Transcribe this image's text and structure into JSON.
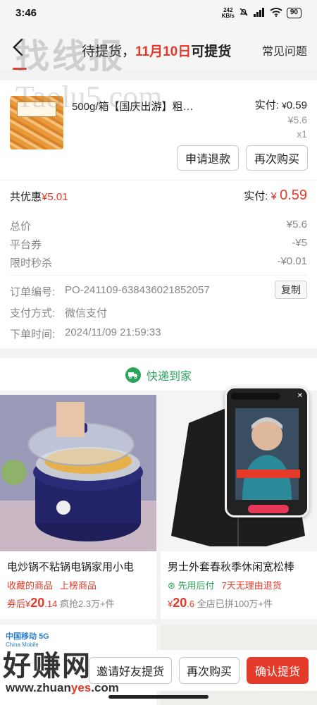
{
  "status_bar": {
    "time": "3:46",
    "speed": "242",
    "speed_unit": "KB/s",
    "battery": "90"
  },
  "header": {
    "title_prefix": "待提货，",
    "title_date": "11月10日",
    "title_suffix": "可提货",
    "faq": "常见问题"
  },
  "watermarks": {
    "top": "找线报",
    "mid": "Taolu5.com",
    "bottom": "好赚网",
    "bottom_url_a": "www.zhuan",
    "bottom_url_b": "yes",
    "bottom_url_c": ".com"
  },
  "product": {
    "name": "500g/箱【国庆出游】粗…",
    "paid_label": "实付:",
    "paid_currency": "¥",
    "paid_value": "0.59",
    "original_price": "¥5.6",
    "quantity": "x1",
    "refund_button": "申请退款",
    "rebuy_button": "再次购买"
  },
  "discount": {
    "label": "共优惠",
    "amount": "¥5.01",
    "paid_label": "实付:",
    "paid_currency": "¥",
    "paid_value": "0.59"
  },
  "breakdown": [
    {
      "label": "总价",
      "value": "¥5.6"
    },
    {
      "label": "平台券",
      "value": "-¥5"
    },
    {
      "label": "限时秒杀",
      "value": "-¥0.01"
    }
  ],
  "order_info": {
    "order_no_label": "订单编号:",
    "order_no": "PO-241109-638436021852057",
    "copy_button": "复制",
    "payment_label": "支付方式:",
    "payment": "微信支付",
    "time_label": "下单时间:",
    "time": "2024/11/09 21:59:33"
  },
  "express": {
    "label": "快递到家"
  },
  "recommendations": [
    {
      "title": "电炒锅不粘锅电锅家用小电",
      "tags": [
        "收藏的商品",
        "上榜商品"
      ],
      "price_prefix": "券后",
      "price_currency": "¥",
      "price_big": "20",
      "price_small": ".14",
      "sold": "疯抢2.3万+件"
    },
    {
      "title": "男士外套春秋季休闲宽松棒",
      "tags": [
        "先用后付",
        "7天无理由退货"
      ],
      "price_currency": "¥",
      "price_big": "20",
      "price_small": ".6",
      "sold": "全店已拼100万+件"
    }
  ],
  "ads": {
    "china_mobile": "中国移动",
    "china_mobile_en": "China Mobile",
    "fiveg": "5G"
  },
  "bottom_bar": {
    "friend_button": "邀请好友提货",
    "rebuy_button": "再次购买",
    "confirm_button": "确认提货"
  },
  "colors": {
    "accent": "#e43a2a",
    "green": "#2aa35b"
  }
}
